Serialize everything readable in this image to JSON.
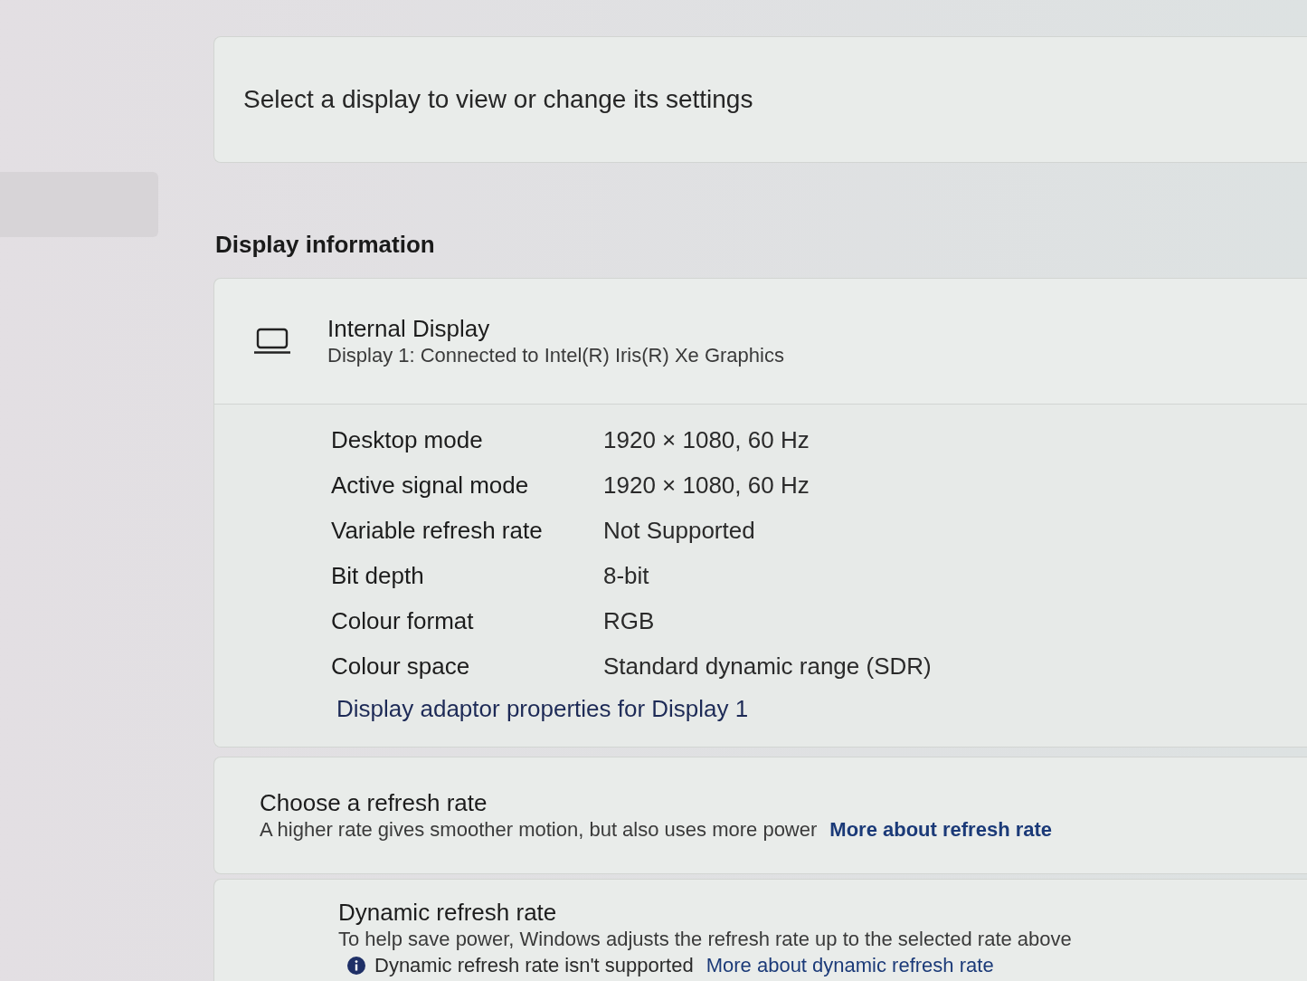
{
  "sidebar": {
    "items": [
      {
        "selected": true
      }
    ]
  },
  "display_select": {
    "prompt": "Select a display to view or change its settings"
  },
  "display_information": {
    "heading": "Display information",
    "display": {
      "title": "Internal Display",
      "subtitle": "Display 1: Connected to Intel(R) Iris(R) Xe Graphics",
      "expanded": true
    },
    "properties": [
      {
        "label": "Desktop mode",
        "value": "1920 × 1080, 60 Hz"
      },
      {
        "label": "Active signal mode",
        "value": "1920 × 1080, 60 Hz"
      },
      {
        "label": "Variable refresh rate",
        "value": "Not Supported"
      },
      {
        "label": "Bit depth",
        "value": "8-bit"
      },
      {
        "label": "Colour format",
        "value": "RGB"
      },
      {
        "label": "Colour space",
        "value": "Standard dynamic range (SDR)"
      }
    ],
    "adapter_link": "Display adaptor properties for Display 1"
  },
  "refresh_rate": {
    "title": "Choose a refresh rate",
    "description": "A higher rate gives smoother motion, but also uses more power",
    "link": "More about refresh rate"
  },
  "dynamic_refresh_rate": {
    "title": "Dynamic refresh rate",
    "description": "To help save power, Windows adjusts the refresh rate up to the selected rate above",
    "notice": {
      "text": "Dynamic refresh rate isn't supported",
      "link": "More about dynamic refresh rate"
    }
  }
}
